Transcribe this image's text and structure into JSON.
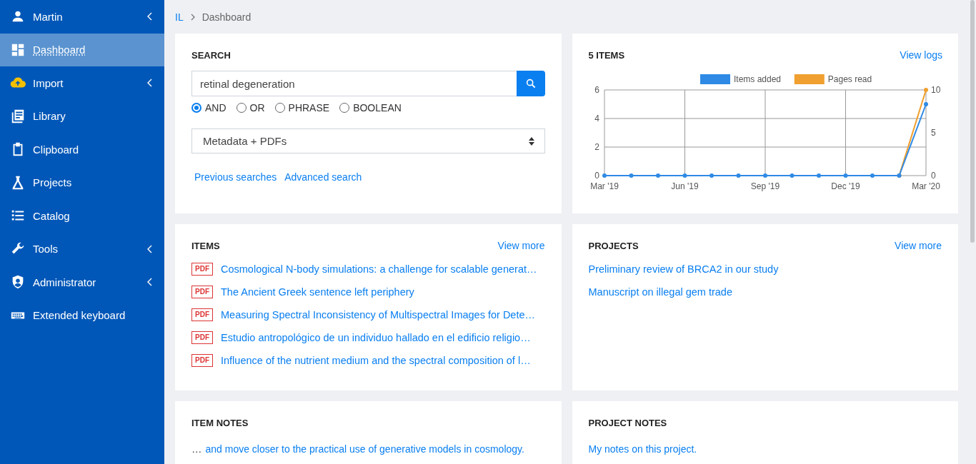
{
  "sidebar": {
    "items": [
      {
        "label": "Martin",
        "expandable": true,
        "selected": false
      },
      {
        "label": "Dashboard",
        "expandable": false,
        "selected": true
      },
      {
        "label": "Import",
        "expandable": true,
        "selected": false
      },
      {
        "label": "Library",
        "expandable": false,
        "selected": false
      },
      {
        "label": "Clipboard",
        "expandable": false,
        "selected": false
      },
      {
        "label": "Projects",
        "expandable": false,
        "selected": false
      },
      {
        "label": "Catalog",
        "expandable": false,
        "selected": false
      },
      {
        "label": "Tools",
        "expandable": true,
        "selected": false
      },
      {
        "label": "Administrator",
        "expandable": true,
        "selected": false
      },
      {
        "label": "Extended keyboard",
        "expandable": false,
        "selected": false
      }
    ]
  },
  "breadcrumb": [
    {
      "label": "IL",
      "kind": "link"
    },
    {
      "label": "Dashboard",
      "kind": "current"
    }
  ],
  "search": {
    "title": "SEARCH",
    "query": "retinal degeneration",
    "modes": [
      {
        "label": "AND",
        "selected": true
      },
      {
        "label": "OR",
        "selected": false
      },
      {
        "label": "PHRASE",
        "selected": false
      },
      {
        "label": "BOOLEAN",
        "selected": false
      }
    ],
    "scope": "Metadata + PDFs",
    "links": [
      "Previous searches",
      "Advanced search"
    ]
  },
  "activity": {
    "title": "5 ITEMS",
    "link": "View logs",
    "chart_data": {
      "type": "line",
      "categories": [
        "Mar '19",
        null,
        null,
        "Jun '19",
        null,
        null,
        "Sep '19",
        null,
        null,
        "Dec '19",
        null,
        null,
        "Mar '20"
      ],
      "grid": true,
      "legend": "top",
      "ylim": [
        0,
        6
      ],
      "yticks": [
        0,
        2,
        4,
        6
      ],
      "y2lim": [
        0,
        10
      ],
      "y2ticks": [
        0,
        5,
        10
      ],
      "series": [
        {
          "name": "Items added",
          "color": "#2f8ae5",
          "marker": "circle",
          "values": [
            0,
            0,
            0,
            0,
            0,
            0,
            0,
            0,
            0,
            0,
            0,
            0,
            5
          ]
        },
        {
          "name": "Pages read",
          "color": "#f0a030",
          "axis": "y2",
          "marker": "circle",
          "values": [
            null,
            null,
            null,
            null,
            null,
            null,
            null,
            null,
            null,
            null,
            null,
            0,
            10
          ]
        }
      ]
    }
  },
  "items": {
    "title": "ITEMS",
    "link": "View more",
    "rows": [
      {
        "badge": "PDF",
        "title": "Cosmological N-body simulations: a challenge for scalable generat…"
      },
      {
        "badge": "PDF",
        "title": "The Ancient Greek sentence left periphery"
      },
      {
        "badge": "PDF",
        "title": "Measuring Spectral Inconsistency of Multispectral Images for Dete…"
      },
      {
        "badge": "PDF",
        "title": "Estudio antropológico de un individuo hallado en el edificio religio…"
      },
      {
        "badge": "PDF",
        "title": "Influence of the nutrient medium and the spectral composition of l…"
      }
    ]
  },
  "projects": {
    "title": "PROJECTS",
    "link": "View more",
    "rows": [
      {
        "title": "Preliminary review of BRCA2 in our study"
      },
      {
        "title": "Manuscript on illegal gem trade"
      }
    ]
  },
  "item_notes": {
    "title": "ITEM NOTES",
    "notes": [
      {
        "prefix": "…",
        "text": "and move closer to the practical use of generative models in cosmology."
      }
    ]
  },
  "project_notes": {
    "title": "PROJECT NOTES",
    "notes": [
      {
        "text": "My notes on this project."
      }
    ]
  }
}
